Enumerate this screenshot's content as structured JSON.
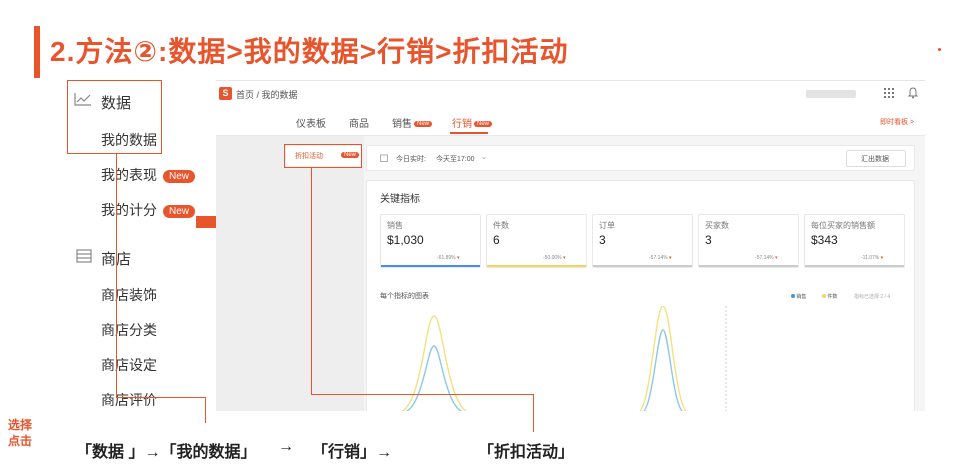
{
  "title": "2.方法②:数据>我的数据>行销>折扣活动",
  "menu": {
    "section_data": "数据",
    "items_data": [
      {
        "label": "我的数据"
      },
      {
        "label": "我的表现",
        "badge": "New"
      },
      {
        "label": "我的计分",
        "badge": "New"
      }
    ],
    "section_shop": "商店",
    "items_shop": [
      {
        "label": "商店装饰"
      },
      {
        "label": "商店分类"
      },
      {
        "label": "商店设定"
      },
      {
        "label": "商店评价"
      }
    ]
  },
  "screen": {
    "logo": "S",
    "breadcrumb": "首页 / 我的数据",
    "tabs": [
      {
        "label": "仪表板"
      },
      {
        "label": "商品"
      },
      {
        "label": "销售",
        "badge": "New"
      },
      {
        "label": "行销",
        "badge": "New"
      }
    ],
    "right_link": "即时看板 >",
    "side_item": "折扣活动",
    "side_badge": "New",
    "realtime_label": "今日实时:",
    "realtime_value": "今天至17:00",
    "export_label": "汇出数据",
    "key_metrics_title": "关键指标",
    "metrics": [
      {
        "label": "销售",
        "value": "$1,030",
        "change": "-61.89%",
        "color": "#4a90e2"
      },
      {
        "label": "件数",
        "value": "6",
        "change": "-50.00%",
        "color": "#f3d55b"
      },
      {
        "label": "订单",
        "value": "3",
        "change": "-57.14%",
        "color": "#cccccc"
      },
      {
        "label": "买家数",
        "value": "3",
        "change": "-57.14%",
        "color": "#cccccc"
      },
      {
        "label": "每位买家的销售额",
        "value": "$343",
        "change": "-11.07%",
        "color": "#cccccc"
      }
    ],
    "chart_title": "每个指标的图表",
    "legend": [
      {
        "name": "销售",
        "color": "#4a90e2"
      },
      {
        "name": "件数",
        "color": "#f3d55b"
      }
    ],
    "legend_extra": "指标已选择 2 / 4"
  },
  "select_label_1": "选择",
  "select_label_2": "点击",
  "bottom_steps": [
    "「数据 」→「我的数据」",
    "→",
    "「行销」→",
    "「折扣活动」"
  ]
}
